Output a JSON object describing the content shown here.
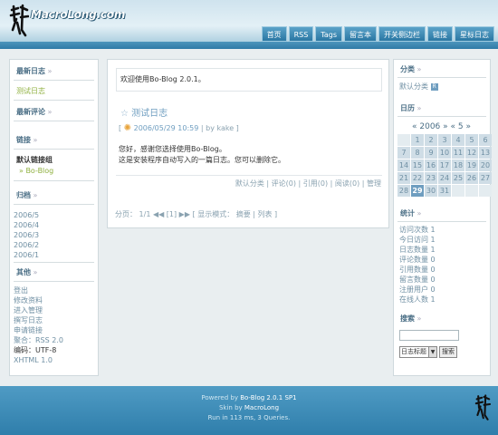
{
  "header": {
    "site_name": "MacroLong.com",
    "nav": [
      "首页",
      "RSS",
      "Tags",
      "留言本",
      "开关侧边栏",
      "链接",
      "星标日志"
    ]
  },
  "left": {
    "latest_posts": {
      "title": "最新日志",
      "items": [
        "测试日志"
      ]
    },
    "latest_comments": {
      "title": "最新评论"
    },
    "links": {
      "title": "链接",
      "group": "默认链接组",
      "items": [
        "Bo-Blog"
      ]
    },
    "archive": {
      "title": "归档",
      "items": [
        "2006/5",
        "2006/4",
        "2006/3",
        "2006/2",
        "2006/1"
      ]
    },
    "misc": {
      "title": "其他",
      "items": [
        "登出",
        "修改资料",
        "进入管理",
        "撰写日志",
        "申请链接",
        "聚合：RSS 2.0",
        "编码：UTF-8",
        "XHTML 1.0"
      ]
    }
  },
  "main": {
    "welcome": "欢迎使用Bo-Blog 2.0.1。",
    "post": {
      "title": "测试日志",
      "meta_open": "[",
      "date": "2006/05/29 10:59",
      "by": "| by kake ]",
      "body_line1": "您好，感谢您选择使用Bo-Blog。",
      "body_line2": "这是安装程序自动写入的一篇日志。您可以删除它。",
      "links": "默认分类 | 评论(0) | 引用(0) | 阅读(0) | 管理"
    },
    "pager": "分页： 1/1 ◀◀ [1] ▶▶ [ 显示模式： 摘要 | 列表 ]"
  },
  "right": {
    "category": {
      "title": "分类",
      "item": "默认分类"
    },
    "calendar": {
      "title": "日历",
      "header": "« 2006 »   « 5 »",
      "cells": [
        "",
        "1",
        "2",
        "3",
        "4",
        "5",
        "6",
        "7",
        "8",
        "9",
        "10",
        "11",
        "12",
        "13",
        "14",
        "15",
        "16",
        "17",
        "18",
        "19",
        "20",
        "21",
        "22",
        "23",
        "24",
        "25",
        "26",
        "27",
        "28",
        "29",
        "30",
        "31",
        "",
        "",
        ""
      ],
      "today": "29"
    },
    "stats": {
      "title": "统计",
      "items": [
        "访问次数 1",
        "今日访问 1",
        "日志数量 1",
        "评论数量 0",
        "引用数量 0",
        "留言数量 0",
        "注册用户 0",
        "在线人数 1"
      ]
    },
    "search": {
      "title": "搜索",
      "select": "日志标题",
      "button": "搜索"
    }
  },
  "footer": {
    "line1_prefix": "Powered by ",
    "line1_link": "Bo-Blog 2.0.1 SP1",
    "line2_prefix": "Skin by ",
    "line2_link": "MacroLong",
    "line3": "Run in 113 ms, 3 Queries."
  }
}
